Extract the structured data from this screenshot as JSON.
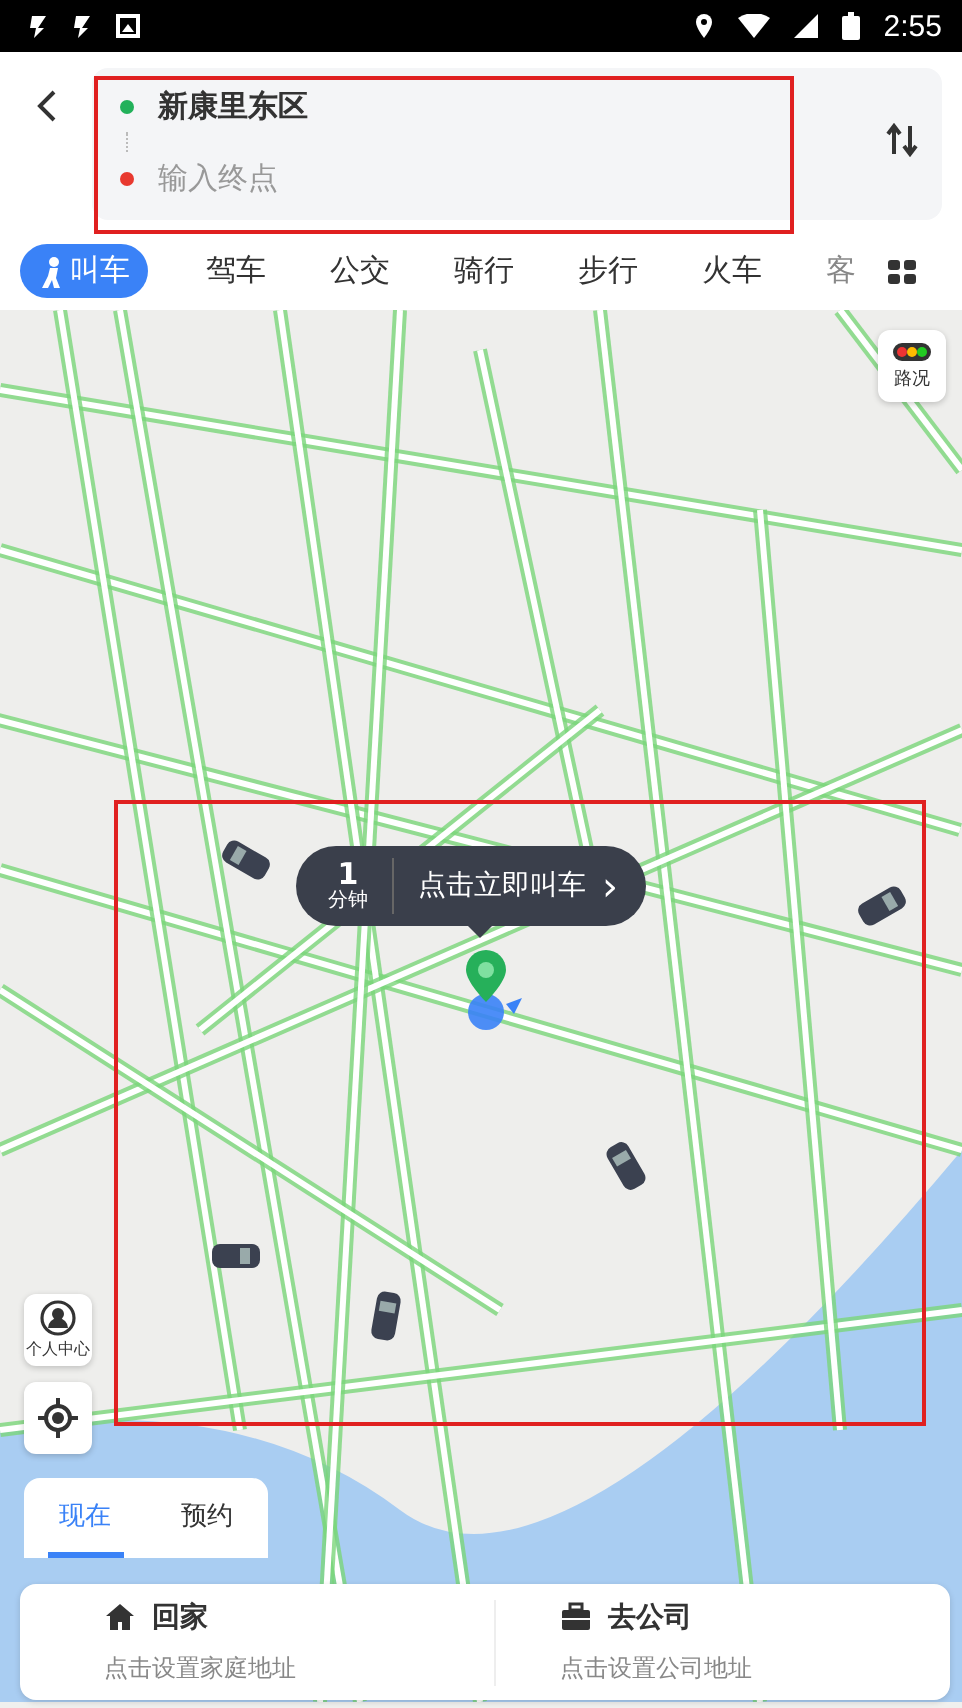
{
  "status_bar": {
    "time": "2:55"
  },
  "route": {
    "origin": "新康里东区",
    "destination_placeholder": "输入终点"
  },
  "modes": [
    {
      "label": "叫车",
      "selected": true
    },
    {
      "label": "驾车",
      "selected": false
    },
    {
      "label": "公交",
      "selected": false
    },
    {
      "label": "骑行",
      "selected": false
    },
    {
      "label": "步行",
      "selected": false
    },
    {
      "label": "火车",
      "selected": false
    },
    {
      "label": "客",
      "selected": false
    }
  ],
  "traffic_button": {
    "label": "路况"
  },
  "pickup_bubble": {
    "minutes": "1",
    "unit": "分钟",
    "action": "点击立即叫车",
    "chevron": "›"
  },
  "profile_button": {
    "label": "个人中心"
  },
  "time_tabs": [
    {
      "label": "现在",
      "selected": true
    },
    {
      "label": "预约",
      "selected": false
    }
  ],
  "shortcuts": [
    {
      "kind": "home",
      "title": "回家",
      "hint": "点击设置家庭地址"
    },
    {
      "kind": "work",
      "title": "去公司",
      "hint": "点击设置公司地址"
    }
  ],
  "highlights": {
    "route_card": true,
    "map_area": true
  }
}
